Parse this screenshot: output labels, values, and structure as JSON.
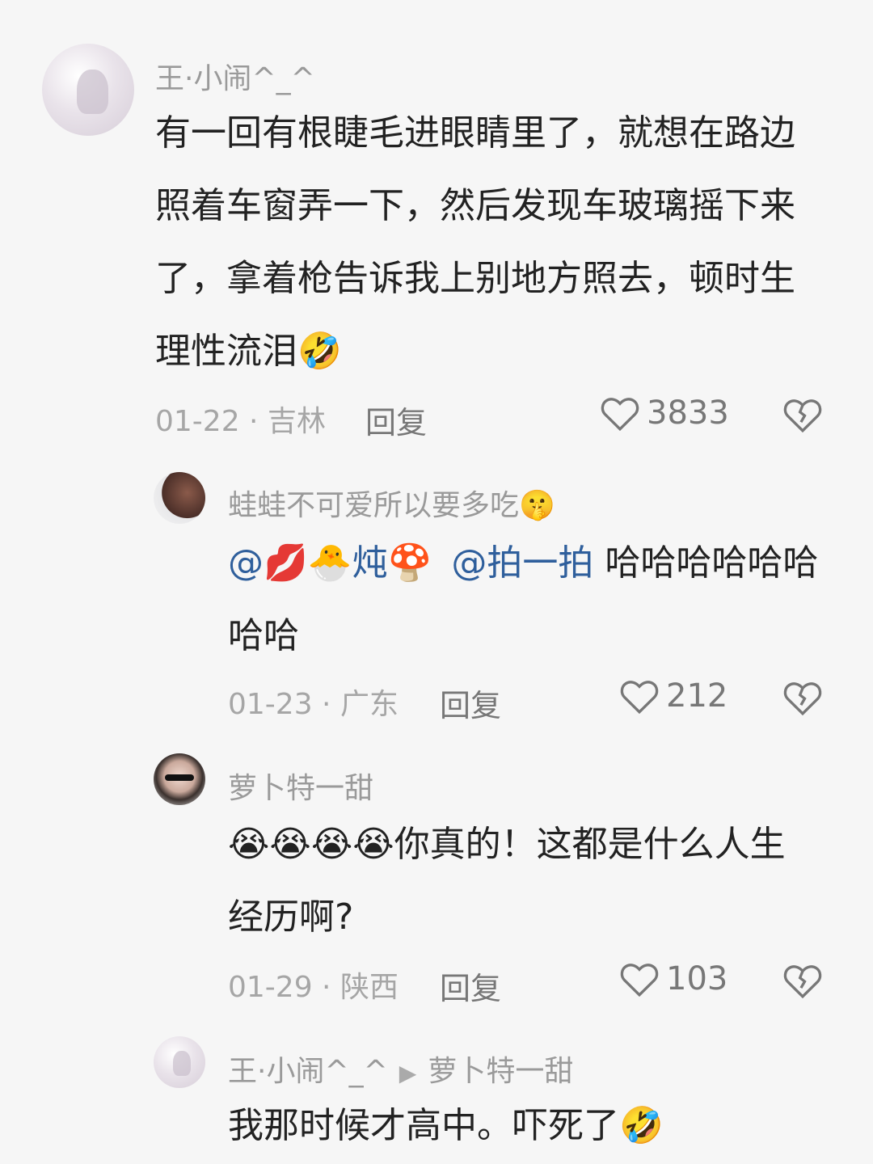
{
  "comments": [
    {
      "username": "王·小闹^_^",
      "lines": [
        "有一回有根睫毛进眼睛里了，就想在路边",
        "照着车窗弄一下，然后发现车玻璃摇下来",
        "了，拿着枪告诉我上别地方照去，顿时生",
        "理性流泪"
      ],
      "trailing_emoji": "🤣",
      "meta": "01-22 · 吉林",
      "reply_label": "回复",
      "likes": "3833"
    },
    {
      "username": "蛙蛙不可爱所以要多吃",
      "username_emoji": "🤫",
      "line1_prefix": "@",
      "line1_emoji1": "💋",
      "line1_emoji2": "🐣",
      "line1_mention_text": "炖",
      "line1_emoji3": "🍄",
      "line1_mention2": "@拍一拍",
      "line1_text": " 哈哈哈哈哈哈",
      "line2": "哈哈",
      "meta": "01-23 · 广东",
      "reply_label": "回复",
      "likes": "212"
    },
    {
      "username": "萝卜特一甜",
      "line1_emojis": "😭😭😭😭",
      "line1_text": "你真的！这都是什么人生",
      "line2": "经历啊?",
      "meta": "01-29 · 陕西",
      "reply_label": "回复",
      "likes": "103"
    },
    {
      "username": "王·小闹^_^",
      "reply_to": "萝卜特一甜",
      "line1": "我那时候才高中。吓死了",
      "trailing_emoji": "🤣"
    }
  ],
  "icons": {
    "like": "heart-outline-icon",
    "dislike": "broken-heart-icon",
    "reply_arrow": "triangle-right-icon"
  },
  "colors": {
    "mention": "#2f5f9c",
    "meta": "#a6a6a6",
    "text": "#222222"
  }
}
